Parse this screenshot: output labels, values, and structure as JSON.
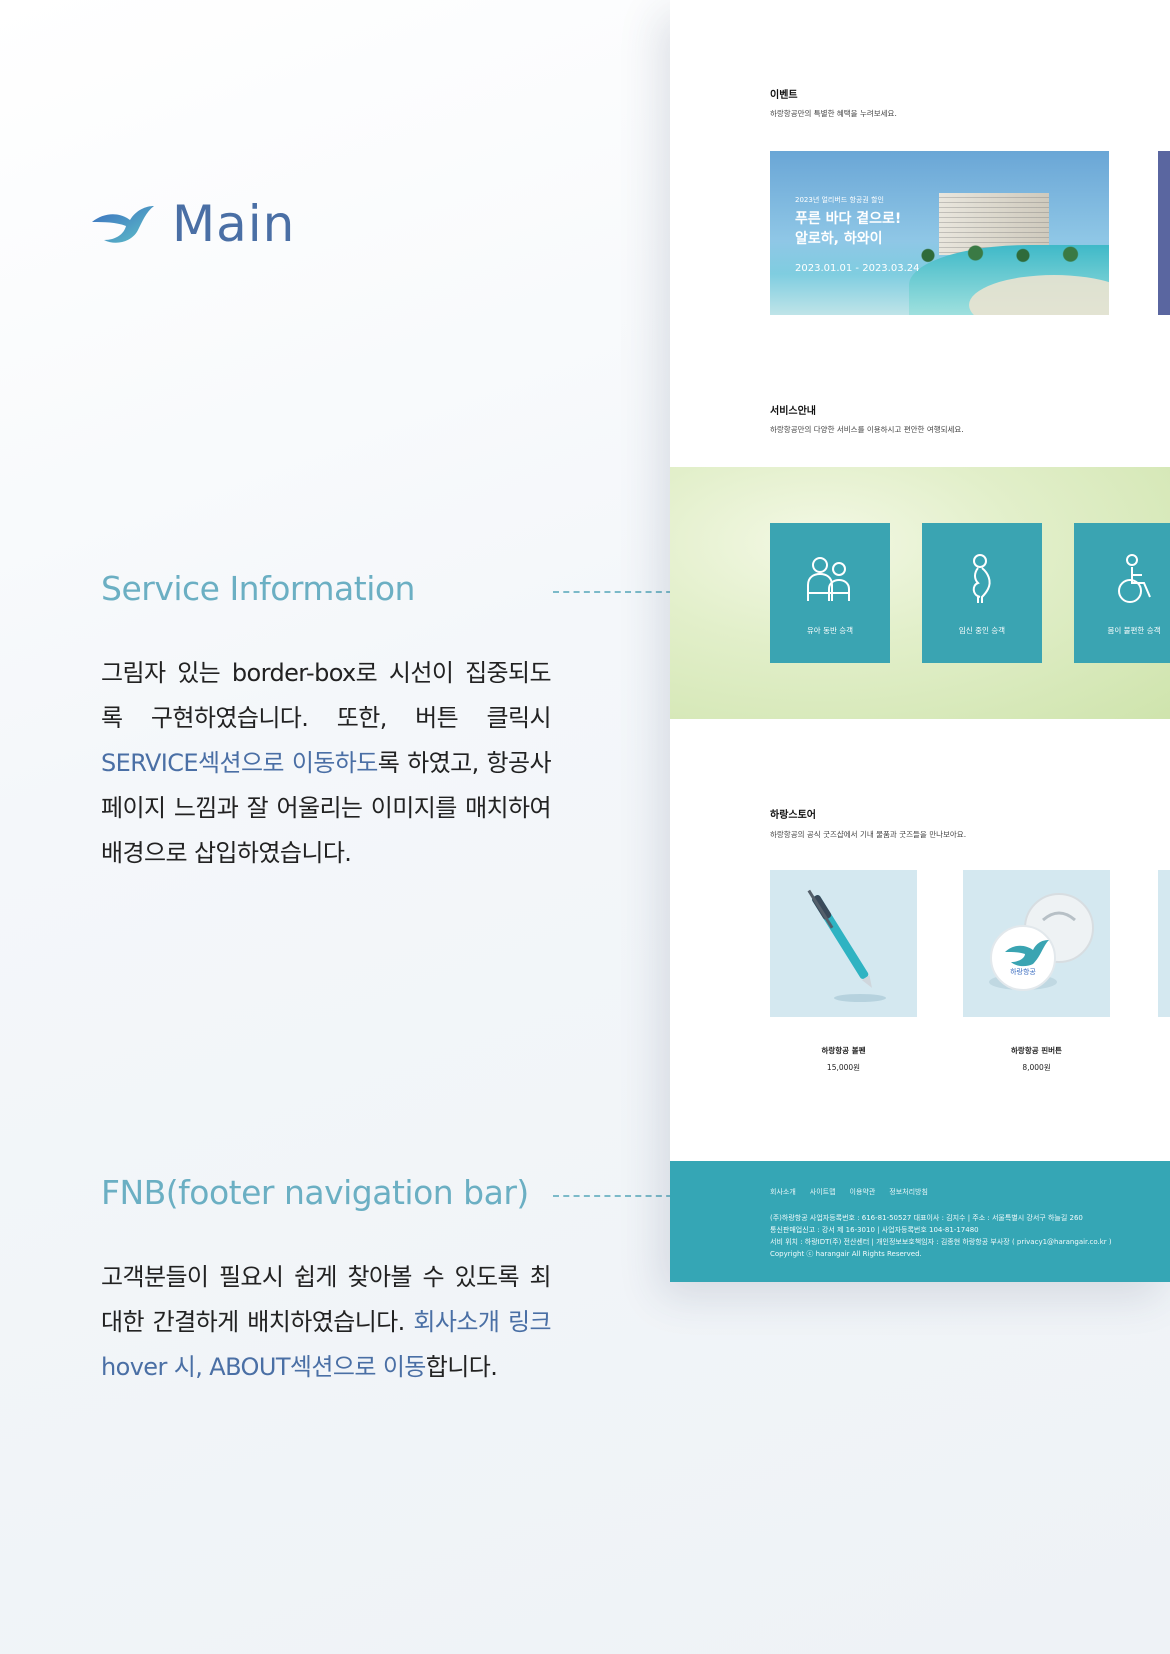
{
  "page": {
    "title": "Main"
  },
  "notes": [
    {
      "title": "Service Information",
      "body_parts": [
        {
          "text": "그림자 있는 border-box로 시선이 집중되도록 구현하였습니다. 또한, 버튼 클릭시 ",
          "highlight": false
        },
        {
          "text": "SERVICE섹션으로 이동하도",
          "highlight": true
        },
        {
          "text": "록 하였고, 항공사 페이지 느낌과 잘 어울리는 이미지를 매치하여 배경으로 삽입하였습니다.",
          "highlight": false
        }
      ]
    },
    {
      "title": "FNB(footer navigation bar)",
      "body_parts": [
        {
          "text": "고객분들이 필요시 쉽게 찾아볼 수 있도록 최대한 간결하게 배치하였습니다. ",
          "highlight": false
        },
        {
          "text": "회사소개 링크 hover 시, ABOUT섹션으로 이동",
          "highlight": true
        },
        {
          "text": "합니다.",
          "highlight": false
        }
      ]
    }
  ],
  "mockup": {
    "event": {
      "title": "이벤트",
      "subtitle": "하랑항공만의 특별한 혜택을 누려보세요.",
      "card": {
        "eyebrow": "2023년 얼리버드 항공권 할인",
        "headline": "푸른 바다 곁으로!\n알로하, 하와이",
        "period": "2023.01.01 - 2023.03.24"
      }
    },
    "service": {
      "title": "서비스안내",
      "subtitle": "하랑항공만의 다양한 서비스를 이용하시고 편안한 여행되세요.",
      "items": [
        {
          "label": "유아 동반 승객",
          "icon": "parent-child-icon"
        },
        {
          "label": "임신 중인 승객",
          "icon": "pregnant-icon"
        },
        {
          "label": "몸이 불편한 승객",
          "icon": "wheelchair-icon"
        }
      ]
    },
    "store": {
      "title": "하랑스토어",
      "subtitle": "하랑항공의 공식 굿즈샵에서 기내 물품과 굿즈들을 만나보아요.",
      "items": [
        {
          "name": "하랑항공 볼펜",
          "price": "15,000원"
        },
        {
          "name": "하랑항공 핀버튼",
          "price": "8,000원"
        }
      ],
      "badge_text": "하랑항공"
    },
    "footer": {
      "nav": [
        "회사소개",
        "사이트맵",
        "이용약관",
        "정보처리방침"
      ],
      "info_lines": [
        "(주)하랑항공 사업자등록번호 : 616-81-50527 대표이사 : 김지수  |  주소 : 서울특별시 강서구 하늘길 260",
        "통신판매업신고 : 강서 제 16-3010  | 사업자등록번호 104-81-17480",
        "서비 위치 : 하랑IDT(주) 전산센터  |  개인정보보호책임자 : 김종현 하랑항공 부사장 ( privacy1@harangair.co.kr )",
        "Copyright ⓒ harangair All Rights Reserved."
      ]
    }
  },
  "colors": {
    "accent_blue": "#4a6fa5",
    "accent_teal": "#6bafc3",
    "service_tile": "#3aa4b2",
    "footer_bg": "#35a6b5"
  }
}
